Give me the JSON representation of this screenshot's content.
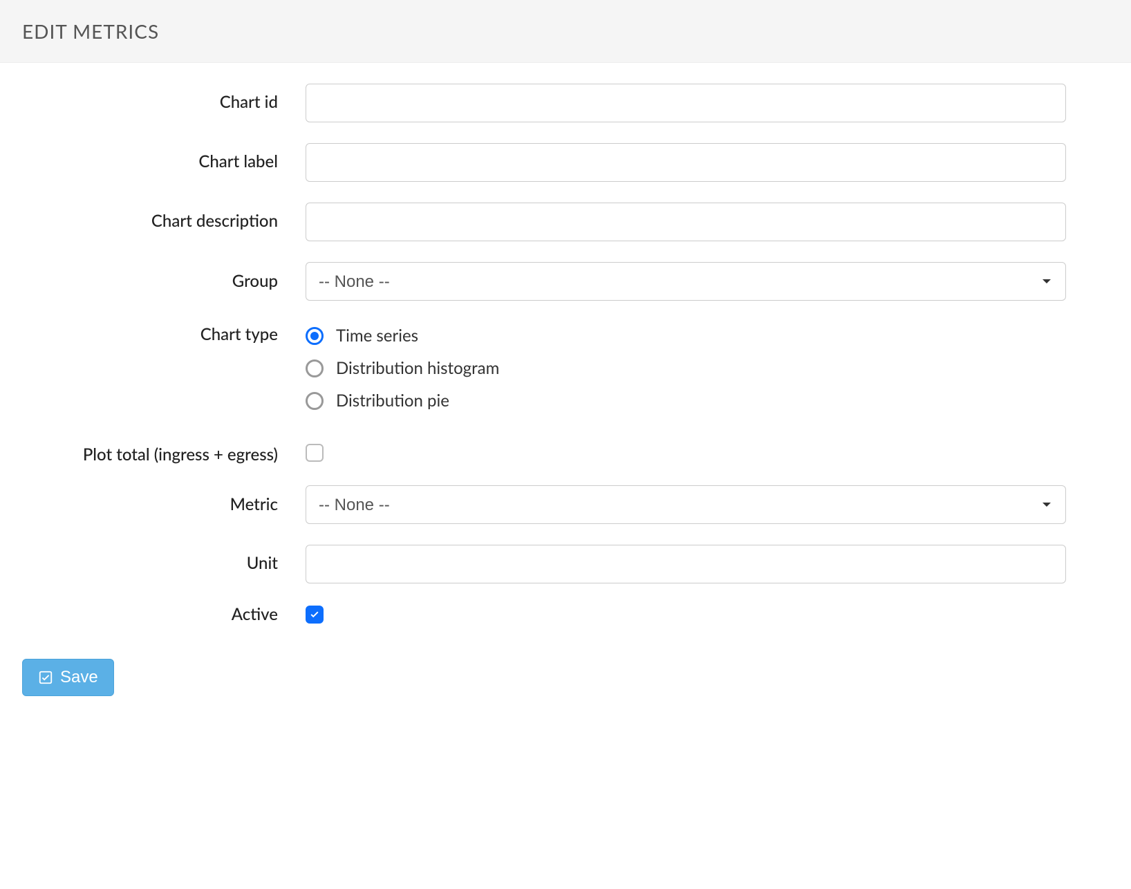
{
  "header": {
    "title": "EDIT METRICS"
  },
  "form": {
    "chart_id": {
      "label": "Chart id",
      "value": ""
    },
    "chart_label": {
      "label": "Chart label",
      "value": ""
    },
    "chart_desc": {
      "label": "Chart description",
      "value": ""
    },
    "group": {
      "label": "Group",
      "selected": "-- None --",
      "options": [
        "-- None --"
      ]
    },
    "chart_type": {
      "label": "Chart type",
      "options": [
        {
          "label": "Time series",
          "checked": true
        },
        {
          "label": "Distribution histogram",
          "checked": false
        },
        {
          "label": "Distribution pie",
          "checked": false
        }
      ]
    },
    "plot_total": {
      "label": "Plot total (ingress + egress)",
      "checked": false
    },
    "metric": {
      "label": "Metric",
      "selected": "-- None --",
      "options": [
        "-- None --"
      ]
    },
    "unit": {
      "label": "Unit",
      "value": ""
    },
    "active": {
      "label": "Active",
      "checked": true
    }
  },
  "footer": {
    "save_label": "Save"
  }
}
